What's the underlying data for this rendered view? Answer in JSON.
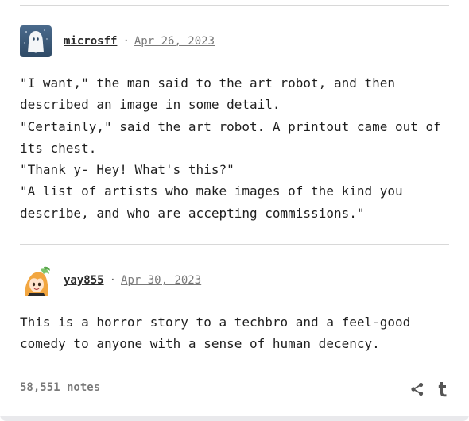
{
  "posts": [
    {
      "username": "microsff",
      "separator": "·",
      "date": "Apr 26, 2023",
      "avatar_icon": "ghost-avatar-icon",
      "paragraphs": [
        "\"I want,\" the man said to the art robot, and then described an image in some detail.",
        "\"Certainly,\" said the art robot. A printout came out of its chest.",
        "\"Thank y- Hey! What's this?\"",
        "\"A list of artists who make images of the kind you describe, and who are accepting commissions.\""
      ]
    },
    {
      "username": "yay855",
      "separator": "·",
      "date": "Apr 30, 2023",
      "avatar_icon": "anime-character-avatar-icon",
      "paragraphs": [
        "This is a horror story to a techbro and a feel-good comedy to anyone with a sense of human decency."
      ]
    }
  ],
  "footer": {
    "notes": "58,551 notes",
    "share_icon": "share-icon",
    "tumblr_icon": "tumblr-icon"
  },
  "colors": {
    "text": "#1f1f1f",
    "muted": "#7a7a7a",
    "divider": "#d8d8d8",
    "icon": "#555555"
  }
}
